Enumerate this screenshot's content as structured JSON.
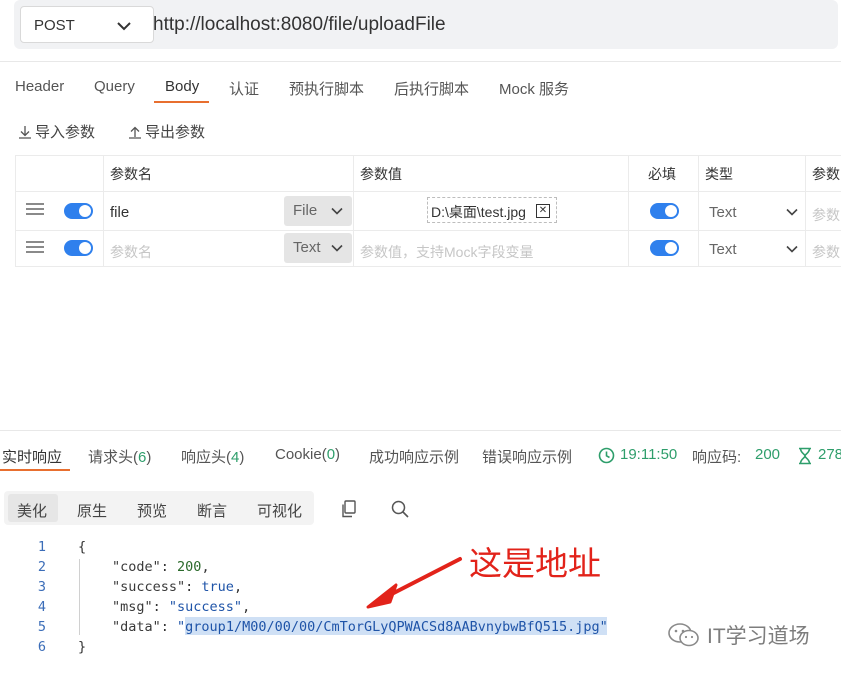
{
  "request": {
    "method": "POST",
    "url": "http://localhost:8080/file/uploadFile"
  },
  "tabs": [
    "Header",
    "Query",
    "Body",
    "认证",
    "预执行脚本",
    "后执行脚本",
    "Mock 服务"
  ],
  "active_tab": "Body",
  "actions": {
    "import": "导入参数",
    "export": "导出参数"
  },
  "params_table": {
    "headers": [
      "参数名",
      "参数值",
      "必填",
      "类型",
      "参数"
    ],
    "rows": [
      {
        "name": "file",
        "kind": "File",
        "value": "D:\\桌面\\test.jpg",
        "required": true,
        "type": "Text",
        "extra": "参数"
      },
      {
        "name_placeholder": "参数名",
        "kind": "Text",
        "value_placeholder": "参数值，支持Mock字段变量",
        "required": true,
        "type": "Text",
        "extra": "参数"
      }
    ]
  },
  "response_tabs": {
    "realtime": "实时响应",
    "req_headers": "请求头(",
    "req_headers_count": "6",
    "resp_headers": "响应头(",
    "resp_headers_count": "4",
    "cookie": "Cookie(",
    "cookie_count": "0",
    "close_paren": ")",
    "success_example": "成功响应示例",
    "error_example": "错误响应示例",
    "time": "19:11:50",
    "status_label": "响应码:",
    "status_code": "200",
    "duration_partial": "278"
  },
  "view_modes": [
    "美化",
    "原生",
    "预览",
    "断言",
    "可视化"
  ],
  "active_view": "美化",
  "code": {
    "line_numbers": [
      "1",
      "2",
      "3",
      "4",
      "5",
      "6"
    ],
    "open_brace": "{",
    "close_brace": "}",
    "code_key": "\"code\"",
    "code_val": "200",
    "success_key": "\"success\"",
    "success_val": "true",
    "msg_key": "\"msg\"",
    "msg_val": "\"success\"",
    "data_key": "\"data\"",
    "data_val": "\"group1/M00/00/00/CmTorGLyQPWACSd8AABvnybwBfQ515.jpg\""
  },
  "annotation": "这是地址",
  "watermark": "IT学习道场",
  "colors": {
    "accent_tab": "#e86f2f",
    "toggle_on": "#2f80ed",
    "success_green": "#2e9e6b",
    "annotation_red": "#e2231a"
  }
}
